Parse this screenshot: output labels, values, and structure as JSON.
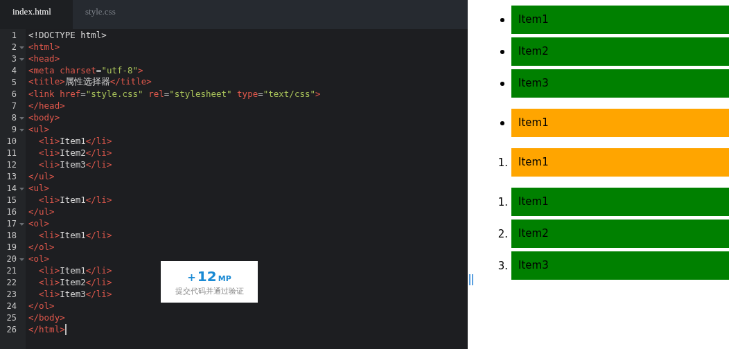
{
  "tabs": [
    {
      "label": "index.html",
      "selected": true
    },
    {
      "label": "style.css",
      "selected": false
    }
  ],
  "code_lines": [
    {
      "number": "1",
      "foldable": false,
      "cursor": false,
      "tokens": [
        {
          "kind": "text",
          "text": "<!DOCTYPE html>"
        }
      ]
    },
    {
      "number": "2",
      "foldable": true,
      "cursor": false,
      "tokens": [
        {
          "kind": "tag",
          "text": "<html>"
        }
      ]
    },
    {
      "number": "3",
      "foldable": true,
      "cursor": false,
      "tokens": [
        {
          "kind": "tag",
          "text": "<head>"
        }
      ]
    },
    {
      "number": "4",
      "foldable": false,
      "cursor": false,
      "tokens": [
        {
          "kind": "tag",
          "text": "<meta"
        },
        {
          "kind": "attr",
          "text": " charset"
        },
        {
          "kind": "punct",
          "text": "="
        },
        {
          "kind": "string",
          "text": "\"utf-8\""
        },
        {
          "kind": "tag",
          "text": ">"
        }
      ]
    },
    {
      "number": "5",
      "foldable": false,
      "cursor": false,
      "tokens": [
        {
          "kind": "tag",
          "text": "<title>"
        },
        {
          "kind": "text",
          "text": "属性选择器"
        },
        {
          "kind": "tag",
          "text": "</title>"
        }
      ]
    },
    {
      "number": "6",
      "foldable": false,
      "cursor": false,
      "tokens": [
        {
          "kind": "tag",
          "text": "<link"
        },
        {
          "kind": "attr",
          "text": " href"
        },
        {
          "kind": "punct",
          "text": "="
        },
        {
          "kind": "string",
          "text": "\"style.css\""
        },
        {
          "kind": "attr",
          "text": " rel"
        },
        {
          "kind": "punct",
          "text": "="
        },
        {
          "kind": "string",
          "text": "\"stylesheet\""
        },
        {
          "kind": "attr",
          "text": " type"
        },
        {
          "kind": "punct",
          "text": "="
        },
        {
          "kind": "string",
          "text": "\"text/css\""
        },
        {
          "kind": "tag",
          "text": ">"
        }
      ]
    },
    {
      "number": "7",
      "foldable": false,
      "cursor": false,
      "tokens": [
        {
          "kind": "tag",
          "text": "</head>"
        }
      ]
    },
    {
      "number": "8",
      "foldable": true,
      "cursor": false,
      "tokens": [
        {
          "kind": "tag",
          "text": "<body>"
        }
      ]
    },
    {
      "number": "9",
      "foldable": true,
      "cursor": false,
      "tokens": [
        {
          "kind": "tag",
          "text": "<ul>"
        }
      ]
    },
    {
      "number": "10",
      "foldable": false,
      "cursor": false,
      "tokens": [
        {
          "kind": "tag",
          "text": "  <li>"
        },
        {
          "kind": "text",
          "text": "Item1"
        },
        {
          "kind": "tag",
          "text": "</li>"
        }
      ]
    },
    {
      "number": "11",
      "foldable": false,
      "cursor": false,
      "tokens": [
        {
          "kind": "tag",
          "text": "  <li>"
        },
        {
          "kind": "text",
          "text": "Item2"
        },
        {
          "kind": "tag",
          "text": "</li>"
        }
      ]
    },
    {
      "number": "12",
      "foldable": false,
      "cursor": false,
      "tokens": [
        {
          "kind": "tag",
          "text": "  <li>"
        },
        {
          "kind": "text",
          "text": "Item3"
        },
        {
          "kind": "tag",
          "text": "</li>"
        }
      ]
    },
    {
      "number": "13",
      "foldable": false,
      "cursor": false,
      "tokens": [
        {
          "kind": "tag",
          "text": "</ul>"
        }
      ]
    },
    {
      "number": "14",
      "foldable": true,
      "cursor": false,
      "tokens": [
        {
          "kind": "tag",
          "text": "<ul>"
        }
      ]
    },
    {
      "number": "15",
      "foldable": false,
      "cursor": false,
      "tokens": [
        {
          "kind": "tag",
          "text": "  <li>"
        },
        {
          "kind": "text",
          "text": "Item1"
        },
        {
          "kind": "tag",
          "text": "</li>"
        }
      ]
    },
    {
      "number": "16",
      "foldable": false,
      "cursor": false,
      "tokens": [
        {
          "kind": "tag",
          "text": "</ul>"
        }
      ]
    },
    {
      "number": "17",
      "foldable": true,
      "cursor": false,
      "tokens": [
        {
          "kind": "tag",
          "text": "<ol>"
        }
      ]
    },
    {
      "number": "18",
      "foldable": false,
      "cursor": false,
      "tokens": [
        {
          "kind": "tag",
          "text": "  <li>"
        },
        {
          "kind": "text",
          "text": "Item1"
        },
        {
          "kind": "tag",
          "text": "</li>"
        }
      ]
    },
    {
      "number": "19",
      "foldable": false,
      "cursor": false,
      "tokens": [
        {
          "kind": "tag",
          "text": "</ol>"
        }
      ]
    },
    {
      "number": "20",
      "foldable": true,
      "cursor": false,
      "tokens": [
        {
          "kind": "tag",
          "text": "<ol>"
        }
      ]
    },
    {
      "number": "21",
      "foldable": false,
      "cursor": false,
      "tokens": [
        {
          "kind": "tag",
          "text": "  <li>"
        },
        {
          "kind": "text",
          "text": "Item1"
        },
        {
          "kind": "tag",
          "text": "</li>"
        }
      ]
    },
    {
      "number": "22",
      "foldable": false,
      "cursor": false,
      "tokens": [
        {
          "kind": "tag",
          "text": "  <li>"
        },
        {
          "kind": "text",
          "text": "Item2"
        },
        {
          "kind": "tag",
          "text": "</li>"
        }
      ]
    },
    {
      "number": "23",
      "foldable": false,
      "cursor": false,
      "tokens": [
        {
          "kind": "tag",
          "text": "  <li>"
        },
        {
          "kind": "text",
          "text": "Item3"
        },
        {
          "kind": "tag",
          "text": "</li>"
        }
      ]
    },
    {
      "number": "24",
      "foldable": false,
      "cursor": false,
      "tokens": [
        {
          "kind": "tag",
          "text": "</ol>"
        }
      ]
    },
    {
      "number": "25",
      "foldable": false,
      "cursor": false,
      "tokens": [
        {
          "kind": "tag",
          "text": "</body>"
        }
      ]
    },
    {
      "number": "26",
      "foldable": false,
      "cursor": true,
      "tokens": [
        {
          "kind": "tag",
          "text": "</html>"
        }
      ]
    }
  ],
  "toast": {
    "plus": "+",
    "amount": "12",
    "unit": "MP",
    "caption": "提交代码并通过验证"
  },
  "preview_lists": [
    {
      "kind": "ul",
      "items": [
        {
          "label": "Item1",
          "color": "#008000"
        },
        {
          "label": "Item2",
          "color": "#008000"
        },
        {
          "label": "Item3",
          "color": "#008000"
        }
      ]
    },
    {
      "kind": "ul",
      "items": [
        {
          "label": "Item1",
          "color": "#ffa500"
        }
      ]
    },
    {
      "kind": "ol",
      "items": [
        {
          "marker": "1.",
          "label": "Item1",
          "color": "#ffa500"
        }
      ]
    },
    {
      "kind": "ol",
      "items": [
        {
          "marker": "1.",
          "label": "Item1",
          "color": "#008000"
        },
        {
          "marker": "2.",
          "label": "Item2",
          "color": "#008000"
        },
        {
          "marker": "3.",
          "label": "Item3",
          "color": "#008000"
        }
      ]
    }
  ]
}
